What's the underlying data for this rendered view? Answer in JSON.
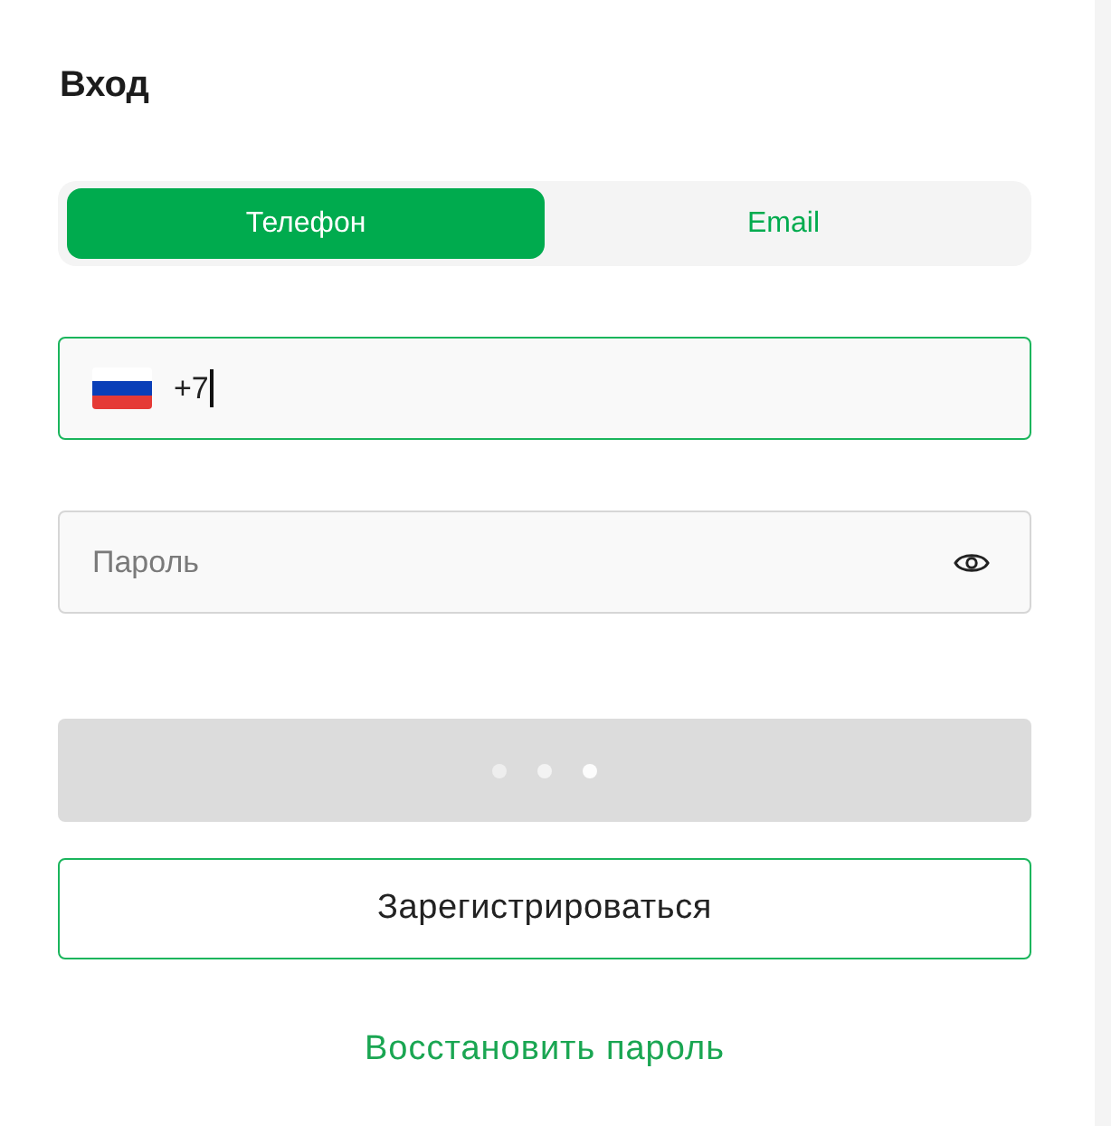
{
  "title": "Вход",
  "tabs": [
    {
      "label": "Телефон",
      "selected": true
    },
    {
      "label": "Email",
      "selected": false
    }
  ],
  "phone_field": {
    "value": "+7",
    "focused": true
  },
  "password_field": {
    "placeholder": "Пароль"
  },
  "login_button": {
    "loading": true
  },
  "register_button": {
    "label": "Зарегистрироваться"
  },
  "restore_link": {
    "label": "Восстановить пароль"
  }
}
